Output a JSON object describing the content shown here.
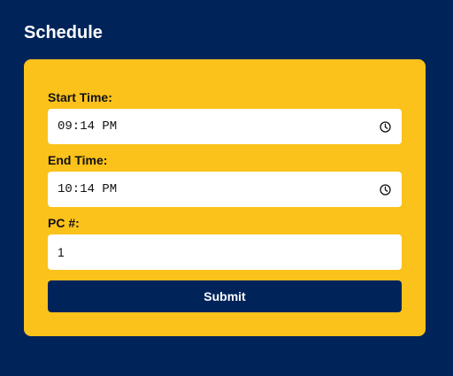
{
  "header": {
    "title": "Schedule"
  },
  "form": {
    "start_time": {
      "label": "Start Time:",
      "value": "09:14 PM",
      "icon": "clock-icon"
    },
    "end_time": {
      "label": "End Time:",
      "value": "10:14 PM",
      "icon": "clock-icon"
    },
    "pc_number": {
      "label": "PC #:",
      "value": "1"
    },
    "submit_label": "Submit"
  },
  "colors": {
    "background": "#00245a",
    "card": "#fbc21b",
    "button": "#00245a",
    "input": "#ffffff"
  }
}
